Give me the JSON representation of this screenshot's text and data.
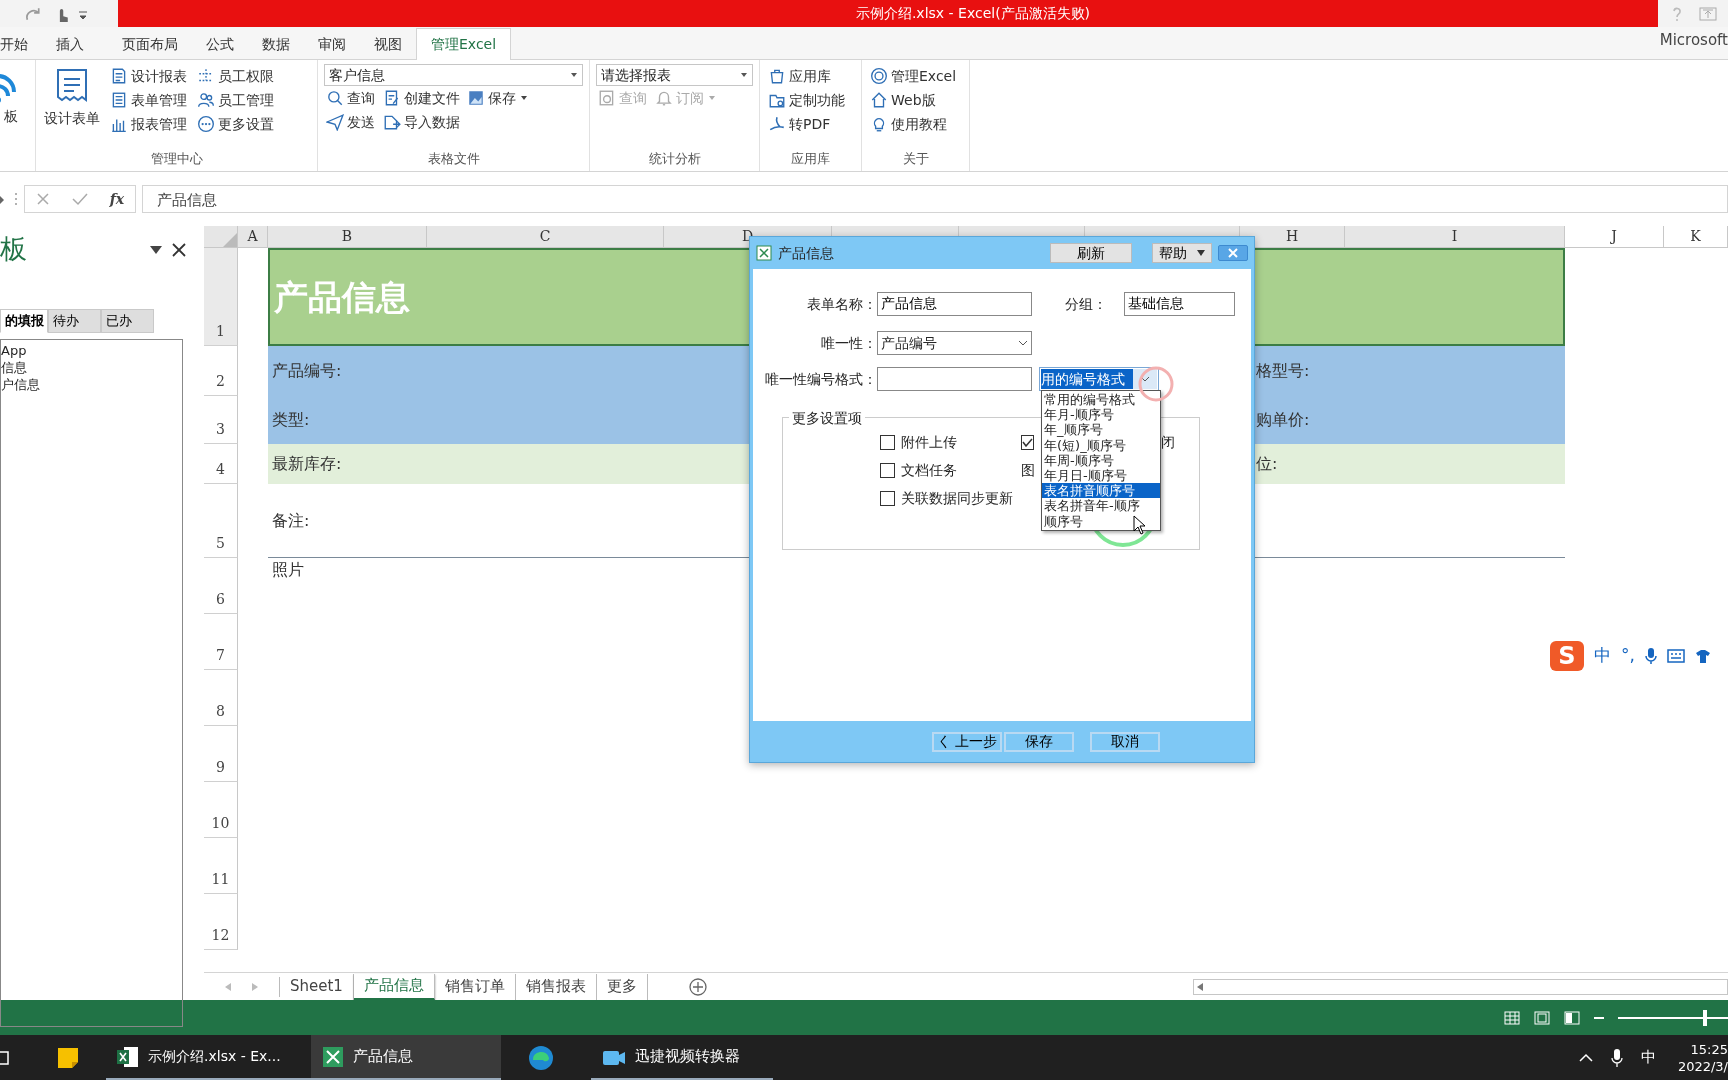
{
  "title_bar": {
    "title": "示例介绍.xlsx -  Excel(产品激活失败)",
    "account": "Microsoft"
  },
  "ribbon_tabs": [
    {
      "label": "开始",
      "selected": false
    },
    {
      "label": "插入",
      "selected": false
    },
    {
      "label": "页面布局",
      "selected": false
    },
    {
      "label": "公式",
      "selected": false
    },
    {
      "label": "数据",
      "selected": false
    },
    {
      "label": "审阅",
      "selected": false
    },
    {
      "label": "视图",
      "selected": false
    },
    {
      "label": "管理Excel",
      "selected": true
    }
  ],
  "ribbon_groups": [
    {
      "kind": "big",
      "large": {
        "label": "板"
      }
    },
    {
      "kind": "columns",
      "label": "管理中心",
      "large": {
        "label": "设计表单"
      },
      "columns": [
        [
          {
            "label": "设计报表",
            "disabled": false,
            "dropdown": false
          },
          {
            "label": "表单管理",
            "disabled": false,
            "dropdown": false
          },
          {
            "label": "报表管理",
            "disabled": false,
            "dropdown": false
          }
        ],
        [
          {
            "label": "员工权限",
            "disabled": false,
            "dropdown": false
          },
          {
            "label": "员工管理",
            "disabled": false,
            "dropdown": false
          },
          {
            "label": "更多设置",
            "disabled": false,
            "dropdown": false
          }
        ]
      ]
    },
    {
      "kind": "rows",
      "label": "表格文件",
      "combo": "客户信息",
      "rows": [
        [
          {
            "label": "查询",
            "disabled": false,
            "dropdown": false
          },
          {
            "label": "创建文件",
            "disabled": false,
            "dropdown": false
          },
          {
            "label": "保存",
            "disabled": false,
            "dropdown": true
          }
        ],
        [
          {
            "label": "发送",
            "disabled": false,
            "dropdown": false
          },
          {
            "label": "导入数据",
            "disabled": false,
            "dropdown": false
          }
        ]
      ]
    },
    {
      "kind": "rows",
      "label": "统计分析",
      "combo": "请选择报表",
      "rows": [
        [
          {
            "label": "查询",
            "disabled": true,
            "dropdown": false
          },
          {
            "label": "订阅",
            "disabled": true,
            "dropdown": true
          }
        ]
      ]
    },
    {
      "kind": "columns",
      "label": "应用库",
      "columns": [
        [
          {
            "label": "应用库",
            "disabled": false,
            "dropdown": false
          },
          {
            "label": "定制功能",
            "disabled": false,
            "dropdown": false
          },
          {
            "label": "转PDF",
            "disabled": false,
            "dropdown": false
          }
        ]
      ]
    },
    {
      "kind": "columns",
      "label": "关于",
      "columns": [
        [
          {
            "label": "管理Excel",
            "disabled": false,
            "dropdown": false
          },
          {
            "label": "Web版",
            "disabled": false,
            "dropdown": false
          },
          {
            "label": "使用教程",
            "disabled": false,
            "dropdown": false
          }
        ]
      ]
    }
  ],
  "formula_bar": {
    "fx": "fx",
    "formula": "产品信息"
  },
  "task_pane": {
    "title": "板",
    "tabs": [
      {
        "label": "的填报",
        "selected": true
      },
      {
        "label": "待办",
        "selected": false
      },
      {
        "label": "已办",
        "selected": false
      }
    ],
    "items": [
      "App",
      "信息",
      "户信息"
    ]
  },
  "sheet": {
    "columns": [
      {
        "kind": "header",
        "label": "A"
      },
      {
        "kind": "header",
        "label": "B"
      },
      {
        "kind": "header",
        "label": "C"
      },
      {
        "kind": "header",
        "label": "D"
      },
      {
        "kind": "covered"
      },
      {
        "kind": "covered"
      },
      {
        "kind": "covered"
      },
      {
        "kind": "header",
        "label": "H"
      },
      {
        "kind": "header",
        "label": "I"
      },
      {
        "kind": "header",
        "label": "J"
      },
      {
        "kind": "header",
        "label": "K"
      }
    ],
    "row_numbers": [
      "1",
      "2",
      "3",
      "4",
      "5",
      "6",
      "7",
      "8",
      "9",
      "10",
      "11",
      "12"
    ],
    "rows": [
      {
        "kind": "title",
        "color": "#a9d08e",
        "left": "产品信息"
      },
      {
        "kind": "field",
        "color": "#9bc2e6",
        "left": "产品编号:",
        "right": "格型号:"
      },
      {
        "kind": "field",
        "color": "#9bc2e6",
        "left": "类型:",
        "right": "购单价:"
      },
      {
        "kind": "field",
        "color": "#e2efda",
        "left": "最新库存:",
        "right": "位:"
      },
      {
        "kind": "memo",
        "color": "#ffffff",
        "left": "备注:"
      },
      {
        "kind": "label",
        "color": "#ffffff",
        "left": "照片"
      }
    ],
    "tabs": [
      {
        "label": "Sheet1",
        "selected": false
      },
      {
        "label": "产品信息",
        "selected": true
      },
      {
        "label": "销售订单",
        "selected": false
      },
      {
        "label": "销售报表",
        "selected": false
      },
      {
        "label": "更多",
        "selected": false
      }
    ]
  },
  "dialog": {
    "title": "产品信息",
    "refresh": "刷新",
    "help": "帮助",
    "form_name_label": "表单名称：",
    "form_name": "产品信息",
    "group_label": "分组：",
    "group": "基础信息",
    "unique_label": "唯一性：",
    "unique": "产品编号",
    "format_label": "唯一性编号格式：",
    "format_combo": "用的编号格式",
    "format_list": [
      {
        "label": "常用的编号格式",
        "selected": false
      },
      {
        "label": "年月-顺序号",
        "selected": false
      },
      {
        "label": "年_顺序号",
        "selected": false
      },
      {
        "label": "年(短)_顺序号",
        "selected": false
      },
      {
        "label": "年周-顺序号",
        "selected": false
      },
      {
        "label": "年月日-顺序号",
        "selected": false
      },
      {
        "label": "表名拼音顺序号",
        "selected": true
      },
      {
        "label": "表名拼音年-顺序",
        "selected": false
      },
      {
        "label": "顺序号",
        "selected": false
      }
    ],
    "more_label": "更多设置项",
    "options": [
      {
        "label": "附件上传",
        "checked": false
      },
      {
        "label": "文档任务",
        "checked": false
      },
      {
        "label": "关联数据同步更新",
        "checked": false
      }
    ],
    "right_options": [
      {
        "label": "闭",
        "checked": true
      }
    ],
    "covered_text": "图",
    "buttons": [
      "く 上一步",
      "保存",
      "取消"
    ]
  },
  "ime_bar": {
    "logo": "S",
    "mode": "中",
    "punctuation": "°,"
  },
  "status_bar": {
    "zoom": {
      "level": 0.5
    }
  },
  "taskbar": {
    "items": [
      {
        "kind": "mail"
      },
      {
        "kind": "notes"
      },
      {
        "kind": "excel",
        "label": "示例介绍.xlsx - Ex...",
        "selected": false
      },
      {
        "kind": "form",
        "label": "产品信息",
        "selected": true
      },
      {
        "kind": "browser"
      },
      {
        "kind": "video",
        "label": "迅捷视频转换器",
        "selected": false
      }
    ],
    "ime": "中",
    "time": "15:25",
    "date": "2022/3/"
  }
}
